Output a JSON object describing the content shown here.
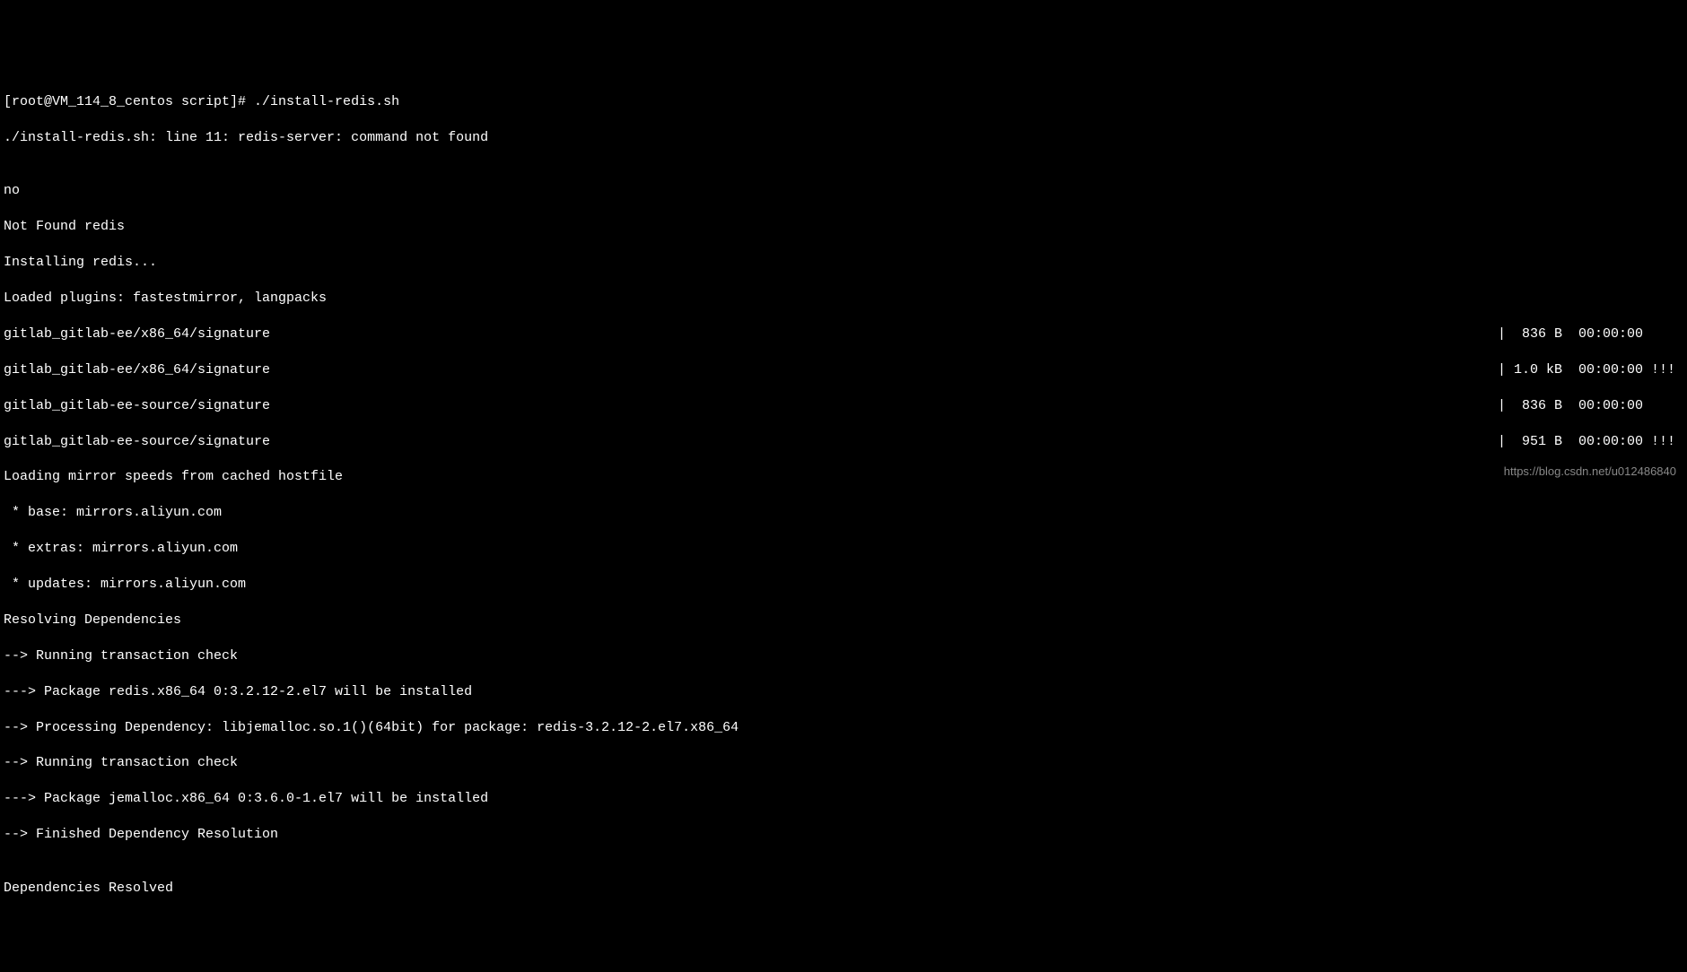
{
  "prompt": "[root@VM_114_8_centos script]# ./install-redis.sh",
  "lines": [
    "./install-redis.sh: line 11: redis-server: command not found",
    "",
    "no",
    "Not Found redis",
    "Installing redis...",
    "Loaded plugins: fastestmirror, langpacks"
  ],
  "repo_lines": [
    {
      "left": "gitlab_gitlab-ee/x86_64/signature",
      "right": "|  836 B  00:00:00     "
    },
    {
      "left": "gitlab_gitlab-ee/x86_64/signature",
      "right": "| 1.0 kB  00:00:00 !!! "
    },
    {
      "left": "gitlab_gitlab-ee-source/signature",
      "right": "|  836 B  00:00:00     "
    },
    {
      "left": "gitlab_gitlab-ee-source/signature",
      "right": "|  951 B  00:00:00 !!! "
    }
  ],
  "after_lines": [
    "Loading mirror speeds from cached hostfile",
    " * base: mirrors.aliyun.com",
    " * extras: mirrors.aliyun.com",
    " * updates: mirrors.aliyun.com",
    "Resolving Dependencies",
    "--> Running transaction check",
    "---> Package redis.x86_64 0:3.2.12-2.el7 will be installed",
    "--> Processing Dependency: libjemalloc.so.1()(64bit) for package: redis-3.2.12-2.el7.x86_64",
    "--> Running transaction check",
    "---> Package jemalloc.x86_64 0:3.6.0-1.el7 will be installed",
    "--> Finished Dependency Resolution",
    "",
    "Dependencies Resolved"
  ],
  "watermark": "https://blog.csdn.net/u012486840"
}
